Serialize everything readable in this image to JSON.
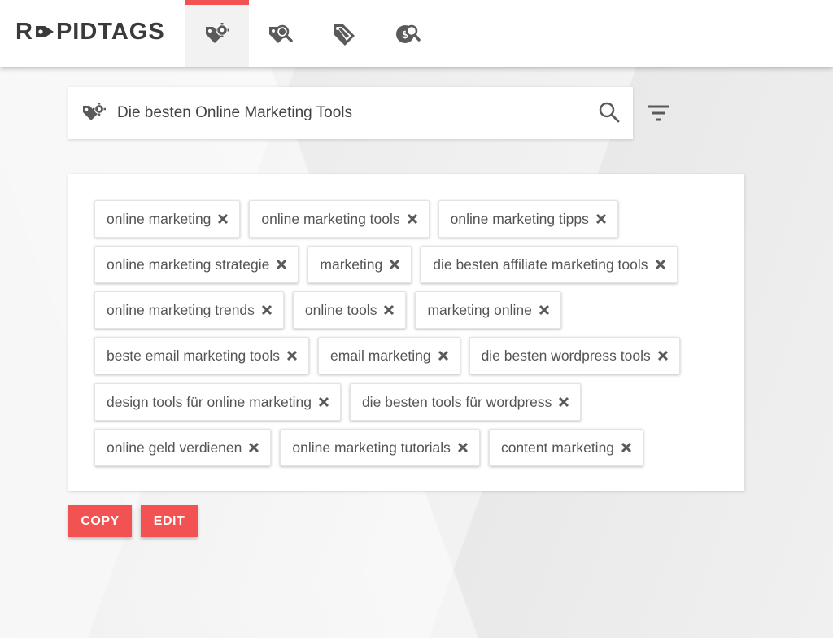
{
  "app": {
    "logo_text_left": "R",
    "logo_text_right": "PIDTAGS",
    "accent_color": "#f25252",
    "icon_color": "#5a5a5a"
  },
  "nav": {
    "tabs": [
      {
        "name": "tag-generator",
        "icon": "tag-gear-icon",
        "active": true
      },
      {
        "name": "tag-search",
        "icon": "tag-magnifier-icon",
        "active": false
      },
      {
        "name": "tag-extractor",
        "icon": "tag-split-icon",
        "active": false
      },
      {
        "name": "tag-money",
        "icon": "coin-search-icon",
        "active": false
      }
    ]
  },
  "search": {
    "value": "Die besten Online Marketing Tools",
    "placeholder": ""
  },
  "tags": [
    [
      "online marketing",
      "online marketing tools",
      "online marketing tipps"
    ],
    [
      "online marketing strategie",
      "marketing",
      "die besten affiliate marketing tools"
    ],
    [
      "online marketing trends",
      "online tools",
      "marketing online"
    ],
    [
      "beste email marketing tools",
      "email marketing",
      "die besten wordpress tools"
    ],
    [
      "design tools für online marketing",
      "die besten tools für wordpress"
    ],
    [
      "online geld verdienen",
      "online marketing tutorials",
      "content marketing"
    ]
  ],
  "actions": {
    "copy_label": "COPY",
    "edit_label": "EDIT"
  }
}
